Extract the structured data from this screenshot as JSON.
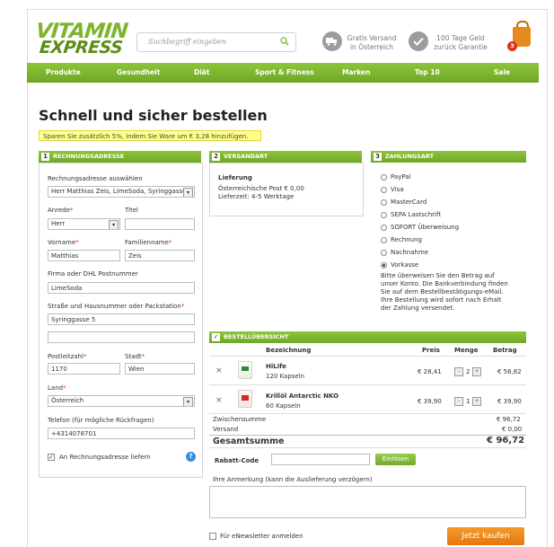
{
  "header": {
    "logo_line1": "VITAMIN",
    "logo_line2": "EXPRESS",
    "search_placeholder": "Suchbegriff eingeben",
    "shipping_line1": "Gratis Versand",
    "shipping_line2": "in Österreich",
    "guarantee_line1": "100 Tage Geld",
    "guarantee_line2": "zurück Garantie",
    "cart_count": "3"
  },
  "nav": [
    "Produkte",
    "Gesundheit",
    "Diät",
    "Sport & Fitness",
    "Marken",
    "Top 10",
    "Sale"
  ],
  "page": {
    "title": "Schnell und sicher bestellen",
    "promo": "Sparen Sie zusätzlich 5%, indem Sie Ware um € 3,28 hinzufügen."
  },
  "billing": {
    "num": "1",
    "heading": "RECHNUNGSADRESSE",
    "select_label": "Rechnungsadresse auswählen",
    "select_value": "Herr Matthias Zeis, LimeSoda, Syringgasse",
    "salutation_label": "Anrede",
    "salutation_value": "Herr",
    "title_label": "Titel",
    "title_value": "",
    "firstname_label": "Vorname",
    "firstname_value": "Matthias",
    "lastname_label": "Familienname",
    "lastname_value": "Zeis",
    "company_label": "Firma oder DHL Postnummer",
    "company_value": "LimeSoda",
    "street_label": "Straße und Hausnummer oder Packstation",
    "street_value": "Syringgasse 5",
    "street2_value": "",
    "zip_label": "Postleitzahl",
    "zip_value": "1170",
    "city_label": "Stadt",
    "city_value": "Wien",
    "country_label": "Land",
    "country_value": "Österreich",
    "phone_label": "Telefon (für mögliche Rückfragen)",
    "phone_value": "+4314078701",
    "ship_same_label": "An Rechnungsadresse liefern",
    "required_mark": "*",
    "help_mark": "?"
  },
  "shipping": {
    "num": "2",
    "heading": "VERSANDART",
    "delivery_label": "Lieferung",
    "method": "Österreichische Post € 0,00",
    "time": "Lieferzeit: 4-5 Werktage"
  },
  "payment": {
    "num": "3",
    "heading": "ZAHLUNGSART",
    "options": [
      "PayPal",
      "Visa",
      "MasterCard",
      "SEPA Lastschrift",
      "SOFORT Überweisung",
      "Rechnung",
      "Nachnahme",
      "Vorkasse"
    ],
    "selected": "Vorkasse",
    "note_lines": [
      "Bitte überweisen Sie den Betrag auf",
      "unser Konto. Die Bankverbindung finden",
      "Sie auf dem Bestellbestätigungs-eMail.",
      "Ihre Bestellung wird sofort nach Erhalt",
      "der Zahlung versendet."
    ]
  },
  "order": {
    "check": "✓",
    "heading": "BESTELLÜBERSICHT",
    "col_name": "Bezeichnung",
    "col_price": "Preis",
    "col_qty": "Menge",
    "col_amount": "Betrag",
    "items": [
      {
        "name": "HiLife",
        "desc": "120 Kapseln",
        "price": "€ 28,41",
        "qty": "2",
        "amount": "€ 56,82"
      },
      {
        "name": "Krillöl Antarctic NKO",
        "desc": "60 Kapseln",
        "price": "€ 39,90",
        "qty": "1",
        "amount": "€ 39,90"
      }
    ],
    "subtotal_label": "Zwischensumme",
    "subtotal_value": "€ 96,72",
    "shipping_label": "Versand",
    "shipping_value": "€ 0,00",
    "total_label": "Gesamtsumme",
    "total_value": "€ 96,72",
    "coupon_label": "Rabatt-Code",
    "coupon_value": "",
    "coupon_button": "Einlösen",
    "remark_label": "Ihre Anmerkung (kann die Auslieferung verzögern)",
    "remark_value": "",
    "newsletter_label": "Für eNewsletter anmelden",
    "buy_button": "Jetzt kaufen",
    "remove_icon": "×",
    "minus": "-",
    "plus": "+"
  },
  "colors": {
    "brand_green": "#7db42c",
    "nav_green": "#6fa726",
    "orange": "#e4780f",
    "promo_yellow": "#ffff8c"
  }
}
